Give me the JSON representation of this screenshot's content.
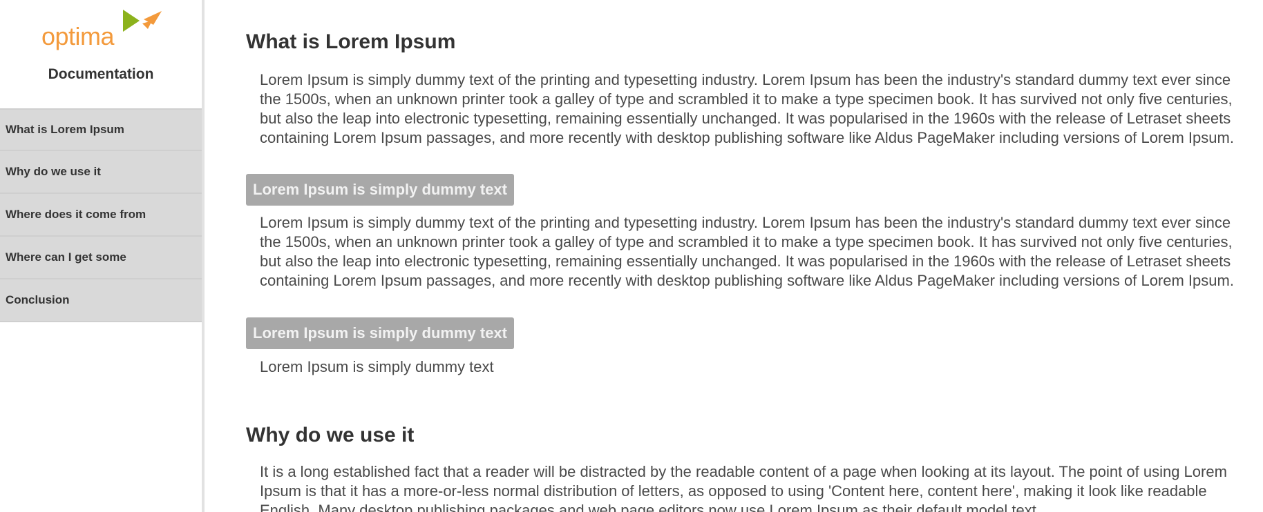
{
  "sidebar": {
    "logo_text": "optima",
    "title": "Documentation",
    "items": [
      {
        "label": "What is Lorem Ipsum"
      },
      {
        "label": "Why do we use it"
      },
      {
        "label": "Where does it come from"
      },
      {
        "label": "Where can I get some"
      },
      {
        "label": "Conclusion"
      }
    ]
  },
  "main": {
    "section1": {
      "title": "What is Lorem Ipsum",
      "para1": "Lorem Ipsum is simply dummy text of the printing and typesetting industry. Lorem Ipsum has been the industry's standard dummy text ever since the 1500s, when an unknown printer took a galley of type and scrambled it to make a type specimen book. It has survived not only five centuries, but also the leap into electronic typesetting, remaining essentially unchanged. It was popularised in the 1960s with the release of Letraset sheets containing Lorem Ipsum passages, and more recently with desktop publishing software like Aldus PageMaker including versions of Lorem Ipsum.",
      "pill1": "Lorem Ipsum is simply dummy text",
      "para2": "Lorem Ipsum is simply dummy text of the printing and typesetting industry. Lorem Ipsum has been the industry's standard dummy text ever since the 1500s, when an unknown printer took a galley of type and scrambled it to make a type specimen book. It has survived not only five centuries, but also the leap into electronic typesetting, remaining essentially unchanged. It was popularised in the 1960s with the release of Letraset sheets containing Lorem Ipsum passages, and more recently with desktop publishing software like Aldus PageMaker including versions of Lorem Ipsum.",
      "pill2": "Lorem Ipsum is simply dummy text",
      "tail": "Lorem Ipsum is simply dummy text"
    },
    "section2": {
      "title": "Why do we use it",
      "para1": "It is a long established fact that a reader will be distracted by the readable content of a page when looking at its layout. The point of using Lorem Ipsum is that it has a more-or-less normal distribution of letters, as opposed to using 'Content here, content here', making it look like readable English. Many desktop publishing packages and web page editors now use Lorem Ipsum as their default model text."
    }
  },
  "colors": {
    "brand_orange": "#f39a3c",
    "brand_green": "#8cb21c",
    "nav_bg": "#d9d9d9",
    "pill_bg": "#a8a8a8"
  },
  "icons": {
    "logo_mark": "optima-arrow-bird-icon"
  }
}
